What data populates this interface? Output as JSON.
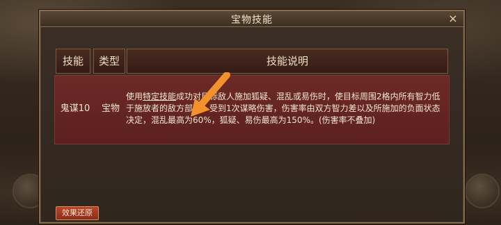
{
  "dialog": {
    "title": "宝物技能",
    "close_icon": "×",
    "footer_button": "效果还原"
  },
  "table": {
    "headers": [
      "技能",
      "类型",
      "技能说明"
    ],
    "row": {
      "name": "鬼谋10",
      "type": "宝物",
      "desc_prefix": "使用",
      "desc_link": "特定技能",
      "desc_rest": "成功对目标敌人施加狐疑、混乱或易伤时，使目标周围2格内所有智力低于施放者的敌方部队，受到1次谋略伤害，伤害率由双方智力差以及所施加的负面状态决定，混乱最高为60%，狐疑、易伤最高为150%。(伤害率不叠加)"
    }
  },
  "colors": {
    "row_bg": "#6d2a26",
    "header_bg": "#4a2a20",
    "arrow": "#f2922b",
    "button": "#b9462c"
  },
  "icons": {
    "arrow": "pointer-arrow-icon",
    "close": "close-icon"
  }
}
